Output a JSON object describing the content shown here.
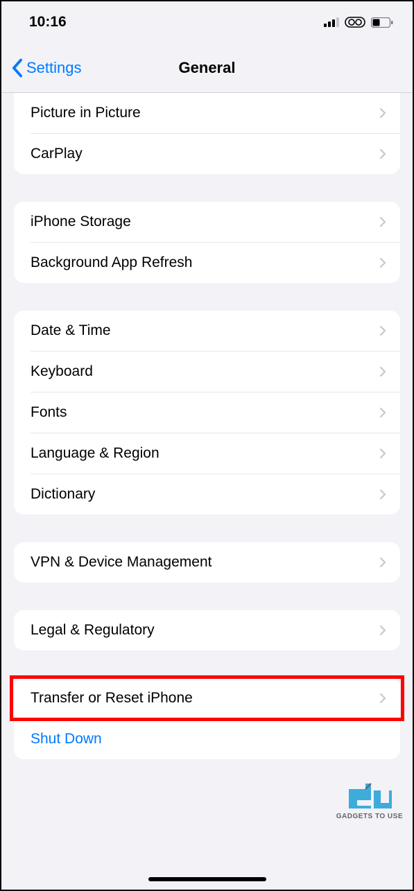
{
  "status_bar": {
    "time": "10:16"
  },
  "nav": {
    "back_label": "Settings",
    "title": "General"
  },
  "groups": {
    "g1": {
      "picture_in_picture": "Picture in Picture",
      "carplay": "CarPlay"
    },
    "g2": {
      "iphone_storage": "iPhone Storage",
      "background_app_refresh": "Background App Refresh"
    },
    "g3": {
      "date_time": "Date & Time",
      "keyboard": "Keyboard",
      "fonts": "Fonts",
      "language_region": "Language & Region",
      "dictionary": "Dictionary"
    },
    "g4": {
      "vpn_device_management": "VPN & Device Management"
    },
    "g5": {
      "legal_regulatory": "Legal & Regulatory"
    },
    "g6": {
      "transfer_reset": "Transfer or Reset iPhone",
      "shut_down": "Shut Down"
    }
  },
  "watermark": {
    "text": "GADGETS TO USE"
  }
}
